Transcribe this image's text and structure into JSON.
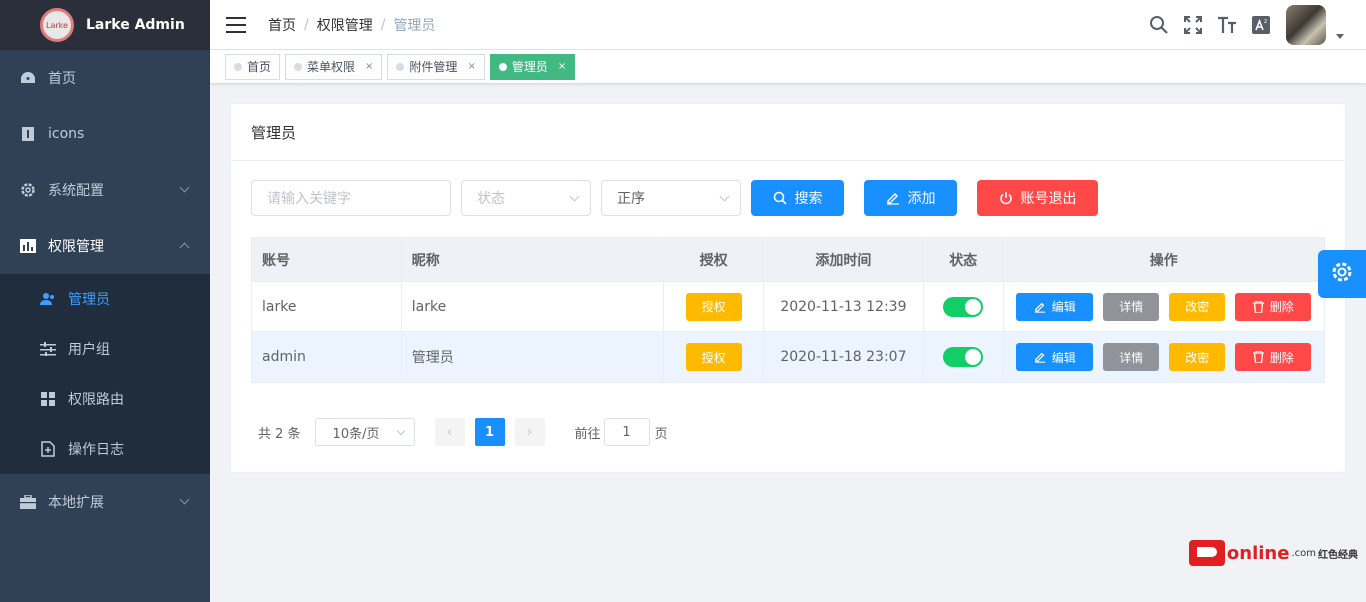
{
  "app": {
    "title": "Larke Admin",
    "logo_text": "Larke"
  },
  "sidebar": {
    "items": [
      {
        "label": "首页",
        "icon": "dashboard-icon"
      },
      {
        "label": "icons",
        "icon": "info-icon"
      },
      {
        "label": "系统配置",
        "icon": "gear-icon"
      },
      {
        "label": "权限管理",
        "icon": "chart-icon"
      },
      {
        "label": "本地扩展",
        "icon": "briefcase-icon"
      }
    ],
    "submenu": [
      {
        "label": "管理员",
        "icon": "users-icon"
      },
      {
        "label": "用户组",
        "icon": "sliders-icon"
      },
      {
        "label": "权限路由",
        "icon": "grid-icon"
      },
      {
        "label": "操作日志",
        "icon": "file-plus-icon"
      }
    ]
  },
  "breadcrumb": {
    "home": "首页",
    "section": "权限管理",
    "current": "管理员",
    "sep": "/"
  },
  "tags": [
    {
      "label": "首页",
      "close": ""
    },
    {
      "label": "菜单权限",
      "close": "×"
    },
    {
      "label": "附件管理",
      "close": "×"
    },
    {
      "label": "管理员",
      "close": "×"
    }
  ],
  "card": {
    "title": "管理员"
  },
  "filters": {
    "keyword_placeholder": "请输入关键字",
    "status_placeholder": "状态",
    "sort_value": "正序",
    "search_label": "搜索",
    "add_label": "添加",
    "logout_label": "账号退出"
  },
  "table": {
    "headers": [
      "账号",
      "昵称",
      "授权",
      "添加时间",
      "状态",
      "操作"
    ],
    "rows": [
      {
        "account": "larke",
        "nickname": "larke",
        "auth": "授权",
        "time": "2020-11-13 12:39",
        "status_on": true
      },
      {
        "account": "admin",
        "nickname": "管理员",
        "auth": "授权",
        "time": "2020-11-18 23:07",
        "status_on": true
      }
    ],
    "actions": {
      "edit": "编辑",
      "detail": "详情",
      "pwd": "改密",
      "delete": "删除"
    }
  },
  "pagination": {
    "total": "共 2 条",
    "page_size": "10条/页",
    "current_page": "1",
    "goto_prefix": "前往",
    "goto_value": "1",
    "goto_suffix": "页",
    "prev": "‹",
    "next": "›"
  },
  "watermark": {
    "brand": "online",
    "domain": ".com",
    "cn": "红色经典"
  },
  "colors": {
    "primary": "#1890ff",
    "success": "#13ce66",
    "warning": "#ffba00",
    "danger": "#ff4949",
    "tag_active": "#42b983",
    "sidebar": "#304156"
  }
}
